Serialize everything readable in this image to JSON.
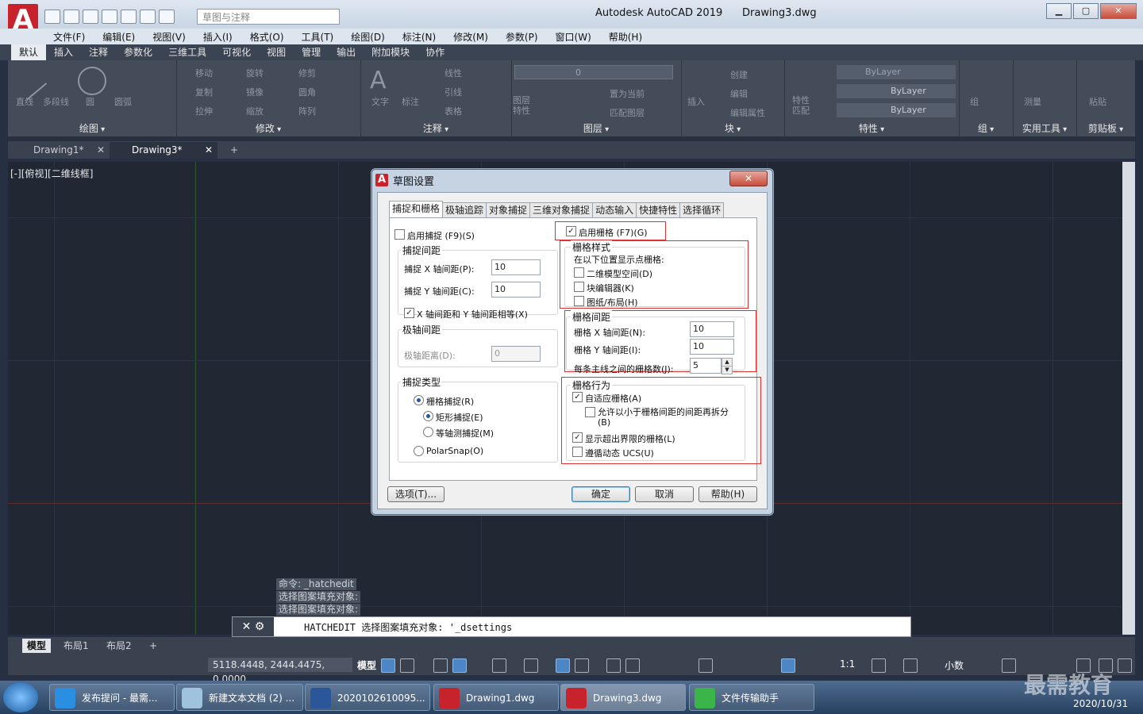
{
  "app": {
    "title": "Autodesk AutoCAD 2019",
    "document": "Drawing3.dwg",
    "workspace_placeholder": "草图与注释",
    "logo": "A"
  },
  "menubar": [
    "文件(F)",
    "编辑(E)",
    "视图(V)",
    "插入(I)",
    "格式(O)",
    "工具(T)",
    "绘图(D)",
    "标注(N)",
    "修改(M)",
    "参数(P)",
    "窗口(W)",
    "帮助(H)"
  ],
  "ribbon_tabs": [
    "默认",
    "插入",
    "注释",
    "参数化",
    "三维工具",
    "可视化",
    "视图",
    "管理",
    "输出",
    "附加模块",
    "协作"
  ],
  "ribbon": {
    "panels": [
      "绘图",
      "修改",
      "注释",
      "图层",
      "块",
      "特性",
      "组",
      "实用工具",
      "剪贴板"
    ],
    "draw_tools": [
      "直线",
      "多段线",
      "圆",
      "圆弧"
    ],
    "modify_tools": [
      "移动",
      "旋转",
      "修剪",
      "复制",
      "镜像",
      "圆角",
      "拉伸",
      "缩放",
      "阵列"
    ],
    "annot_tools": [
      "文字",
      "标注",
      "线性",
      "引线",
      "表格"
    ],
    "layer_tools": [
      "图层特性",
      "置为当前",
      "匹配图层"
    ],
    "layer_current": "0",
    "block_tools": [
      "插入",
      "创建",
      "编辑",
      "编辑属性"
    ],
    "prop_values": [
      "ByLayer",
      "ByLayer",
      "ByLayer"
    ],
    "prop_tools": [
      "特性匹配"
    ],
    "group_tools": [
      "组"
    ],
    "util_tools": [
      "测量"
    ],
    "clip_tools": [
      "粘贴"
    ]
  },
  "doc_tabs": [
    "Drawing1*",
    "Drawing3*"
  ],
  "viewport_label": "[-][俯视][二维线框]",
  "command_history": [
    "命令: _hatchedit",
    "选择图案填充对象:",
    "选择图案填充对象:"
  ],
  "command_line": "HATCHEDIT 选择图案填充对象:  '_dsettings",
  "layout_tabs": [
    "模型",
    "布局1",
    "布局2"
  ],
  "status": {
    "coords": "5118.4448, 2444.4475, 0.0000",
    "model": "模型",
    "scale": "1:1",
    "units": "小数"
  },
  "dialog": {
    "title": "草图设置",
    "tabs": [
      "捕捉和栅格",
      "极轴追踪",
      "对象捕捉",
      "三维对象捕捉",
      "动态输入",
      "快捷特性",
      "选择循环"
    ],
    "snap_on_label": "启用捕捉 (F9)(S)",
    "grid_on_label": "启用栅格 (F7)(G)",
    "snap_spacing": {
      "legend": "捕捉间距",
      "x_label": "捕捉 X 轴间距(P):",
      "x_value": "10",
      "y_label": "捕捉 Y 轴间距(C):",
      "y_value": "10",
      "equal_label": "X 轴间距和 Y 轴间距相等(X)"
    },
    "polar_spacing": {
      "legend": "极轴间距",
      "label": "极轴距离(D):",
      "value": "0"
    },
    "snap_type": {
      "legend": "捕捉类型",
      "grid_snap": "栅格捕捉(R)",
      "rect_snap": "矩形捕捉(E)",
      "iso_snap": "等轴测捕捉(M)",
      "polar_snap": "PolarSnap(O)"
    },
    "grid_style": {
      "legend": "栅格样式",
      "desc": "在以下位置显示点栅格:",
      "model_2d": "二维模型空间(D)",
      "block_editor": "块编辑器(K)",
      "sheet_layout": "图纸/布局(H)"
    },
    "grid_spacing": {
      "legend": "栅格间距",
      "x_label": "栅格 X 轴间距(N):",
      "x_value": "10",
      "y_label": "栅格 Y 轴间距(I):",
      "y_value": "10",
      "major_label": "每条主线之间的栅格数(J):",
      "major_value": "5"
    },
    "grid_behavior": {
      "legend": "栅格行为",
      "adaptive": "自适应栅格(A)",
      "subdivide": "允许以小于栅格间距的间距再拆分(B)",
      "beyond_limits": "显示超出界限的栅格(L)",
      "follow_ucs": "遵循动态 UCS(U)"
    },
    "buttons": {
      "options": "选项(T)...",
      "ok": "确定",
      "cancel": "取消",
      "help": "帮助(H)"
    }
  },
  "taskbar": {
    "tasks": [
      "发布提问 - 最需...",
      "新建文本文档 (2) ...",
      "2020102610095...",
      "Drawing1.dwg",
      "Drawing3.dwg",
      "文件传输助手"
    ],
    "date": "2020/10/31",
    "watermark": "最需教育"
  }
}
